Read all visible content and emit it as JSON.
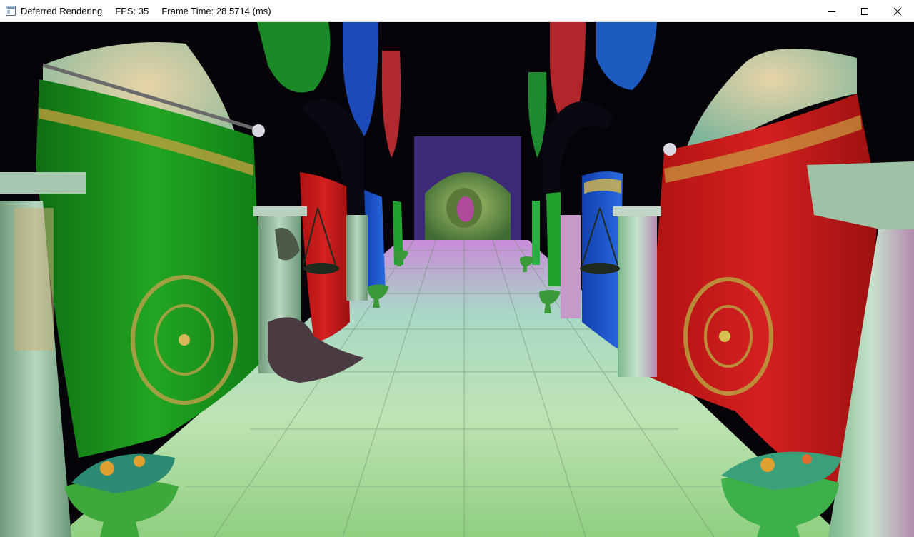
{
  "window": {
    "title": "Deferred Rendering",
    "fps_label": "FPS:",
    "fps_value": "35",
    "frame_time_label": "Frame Time:",
    "frame_time_value": "28.5714",
    "frame_time_unit": "(ms)",
    "icon": "app-window-icon",
    "controls": [
      "minimize-icon",
      "maximize-icon",
      "close-icon"
    ]
  },
  "scene": {
    "description_colors": {
      "green_curtain": "#1a8f1a",
      "red_curtain": "#c41818",
      "blue_curtain": "#1a55c8",
      "floor_tint": "#b9d9b0",
      "pillar": "#9fb8a6"
    }
  }
}
